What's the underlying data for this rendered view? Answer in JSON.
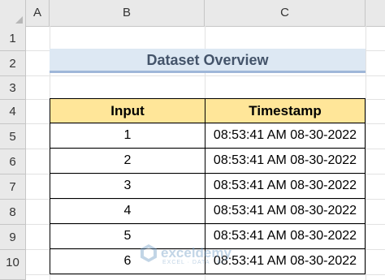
{
  "spreadsheet": {
    "columns": [
      "A",
      "B",
      "C"
    ],
    "rows": [
      "1",
      "2",
      "3",
      "4",
      "5",
      "6",
      "7",
      "8",
      "9",
      "10"
    ],
    "title": "Dataset Overview",
    "table": {
      "headers": {
        "input": "Input",
        "timestamp": "Timestamp"
      },
      "rows": [
        {
          "input": "1",
          "timestamp": "08:53:41 AM 08-30-2022"
        },
        {
          "input": "2",
          "timestamp": "08:53:41 AM 08-30-2022"
        },
        {
          "input": "3",
          "timestamp": "08:53:41 AM 08-30-2022"
        },
        {
          "input": "4",
          "timestamp": "08:53:41 AM 08-30-2022"
        },
        {
          "input": "5",
          "timestamp": "08:53:41 AM 08-30-2022"
        },
        {
          "input": "6",
          "timestamp": "08:53:41 AM 08-30-2022"
        }
      ]
    },
    "watermark": {
      "name": "exceldemy",
      "tagline": "EXCEL · DATA · BI"
    }
  },
  "colors": {
    "header_fill": "#ffe699",
    "title_fill": "#dde8f3",
    "title_text": "#44546a",
    "title_underline": "#9fb7d9"
  }
}
